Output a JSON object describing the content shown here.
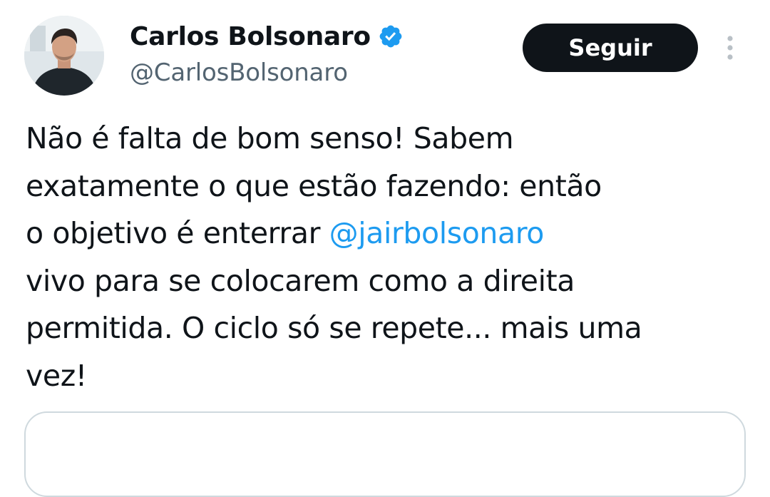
{
  "author": {
    "display_name": "Carlos Bolsonaro",
    "handle": "@CarlosBolsonaro",
    "verified": true,
    "avatar_icon": "profile-photo"
  },
  "actions": {
    "follow_label": "Seguir",
    "more_icon": "more-vertical-icon"
  },
  "tweet": {
    "lines": [
      {
        "text": "Não é falta de bom senso! Sabem"
      },
      {
        "text": "exatamente o que estão fazendo: então"
      },
      {
        "prefix": "o objetivo é enterrar ",
        "mention": "@jairbolsonaro"
      },
      {
        "text": "vivo para se colocarem como a direita"
      },
      {
        "text": "permitida. O ciclo só se repete... mais uma"
      },
      {
        "text": "vez!"
      }
    ]
  },
  "colors": {
    "text": "#0f1419",
    "secondary_text": "#536471",
    "link": "#1d9bf0",
    "verified": "#1d9bf0",
    "button_bg": "#0f1419",
    "button_text": "#ffffff",
    "border": "#cfd9de"
  }
}
